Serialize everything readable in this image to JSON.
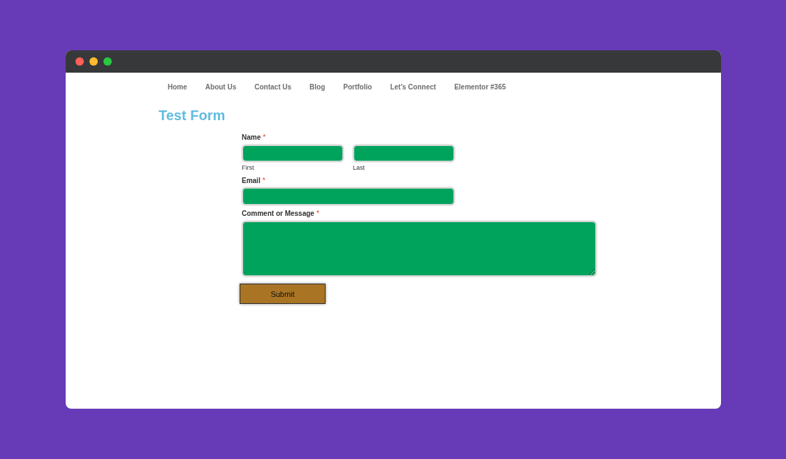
{
  "nav": {
    "items": [
      "Home",
      "About Us",
      "Contact Us",
      "Blog",
      "Portfolio",
      "Let’s Connect",
      "Elementor #365"
    ]
  },
  "page_title": "Test Form",
  "form": {
    "fields": [
      {
        "kind": "name",
        "label": "Name",
        "required_mark": "*",
        "parts": [
          {
            "sublabel": "First"
          },
          {
            "sublabel": "Last"
          }
        ]
      },
      {
        "kind": "email",
        "label": "Email",
        "required_mark": "*"
      },
      {
        "kind": "textarea",
        "label": "Comment or Message",
        "required_mark": "*"
      }
    ],
    "submit": "Submit"
  }
}
